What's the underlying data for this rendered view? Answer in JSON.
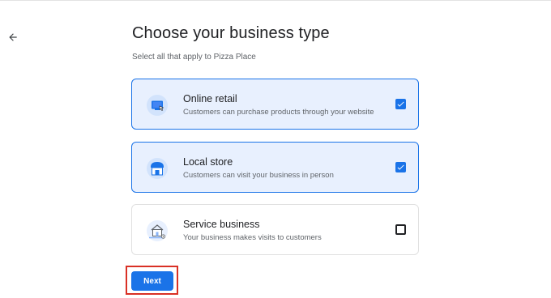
{
  "header": {
    "back_icon": "arrow-back-icon",
    "title": "Choose your business type",
    "subtitle": "Select all that apply to Pizza Place"
  },
  "options": [
    {
      "title": "Online retail",
      "description": "Customers can purchase products through your website",
      "icon": "online-retail-icon",
      "checked": true
    },
    {
      "title": "Local store",
      "description": "Customers can visit your business in person",
      "icon": "store-icon",
      "checked": true
    },
    {
      "title": "Service business",
      "description": "Your business makes visits to customers",
      "icon": "house-location-icon",
      "checked": false
    }
  ],
  "footer": {
    "next_label": "Next"
  },
  "colors": {
    "accent": "#1a73e8",
    "selected_bg": "#e8f0fe",
    "highlight": "#d93025"
  }
}
